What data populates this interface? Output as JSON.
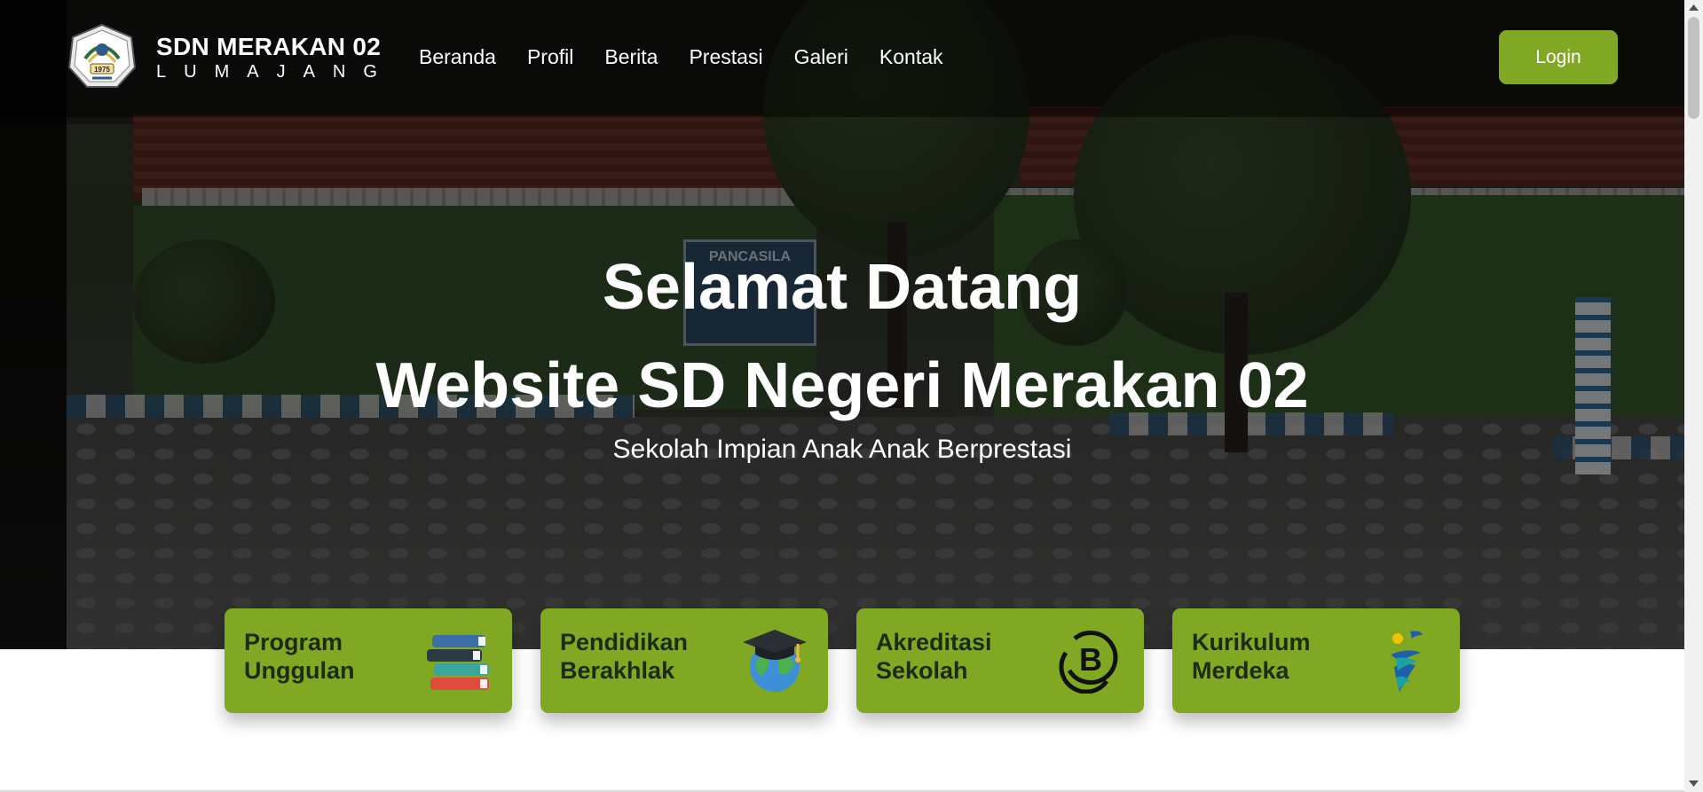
{
  "brand": {
    "name": "SDN MERAKAN 02",
    "city": "LUMAJANG",
    "logo_year": "1975"
  },
  "nav": {
    "items": [
      {
        "label": "Beranda"
      },
      {
        "label": "Profil"
      },
      {
        "label": "Berita"
      },
      {
        "label": "Prestasi"
      },
      {
        "label": "Galeri"
      },
      {
        "label": "Kontak"
      }
    ],
    "login_label": "Login"
  },
  "hero": {
    "title_line1": "Selamat Datang",
    "title_line2": "Website SD Negeri Merakan 02",
    "tagline": "Sekolah Impian Anak Anak Berprestasi",
    "sign_text": "PANCASILA"
  },
  "cards": [
    {
      "line1": "Program",
      "line2": "Unggulan",
      "icon": "books-icon"
    },
    {
      "line1": "Pendidikan",
      "line2": "Berakhlak",
      "icon": "graduation-globe-icon"
    },
    {
      "line1": "Akreditasi",
      "line2": "Sekolah",
      "icon": "accreditation-b-icon"
    },
    {
      "line1": "Kurikulum",
      "line2": "Merdeka",
      "icon": "kurikulum-merdeka-icon"
    }
  ],
  "colors": {
    "accent": "#80a822",
    "card_text": "#1d2a14",
    "header_text": "#ffffff"
  }
}
